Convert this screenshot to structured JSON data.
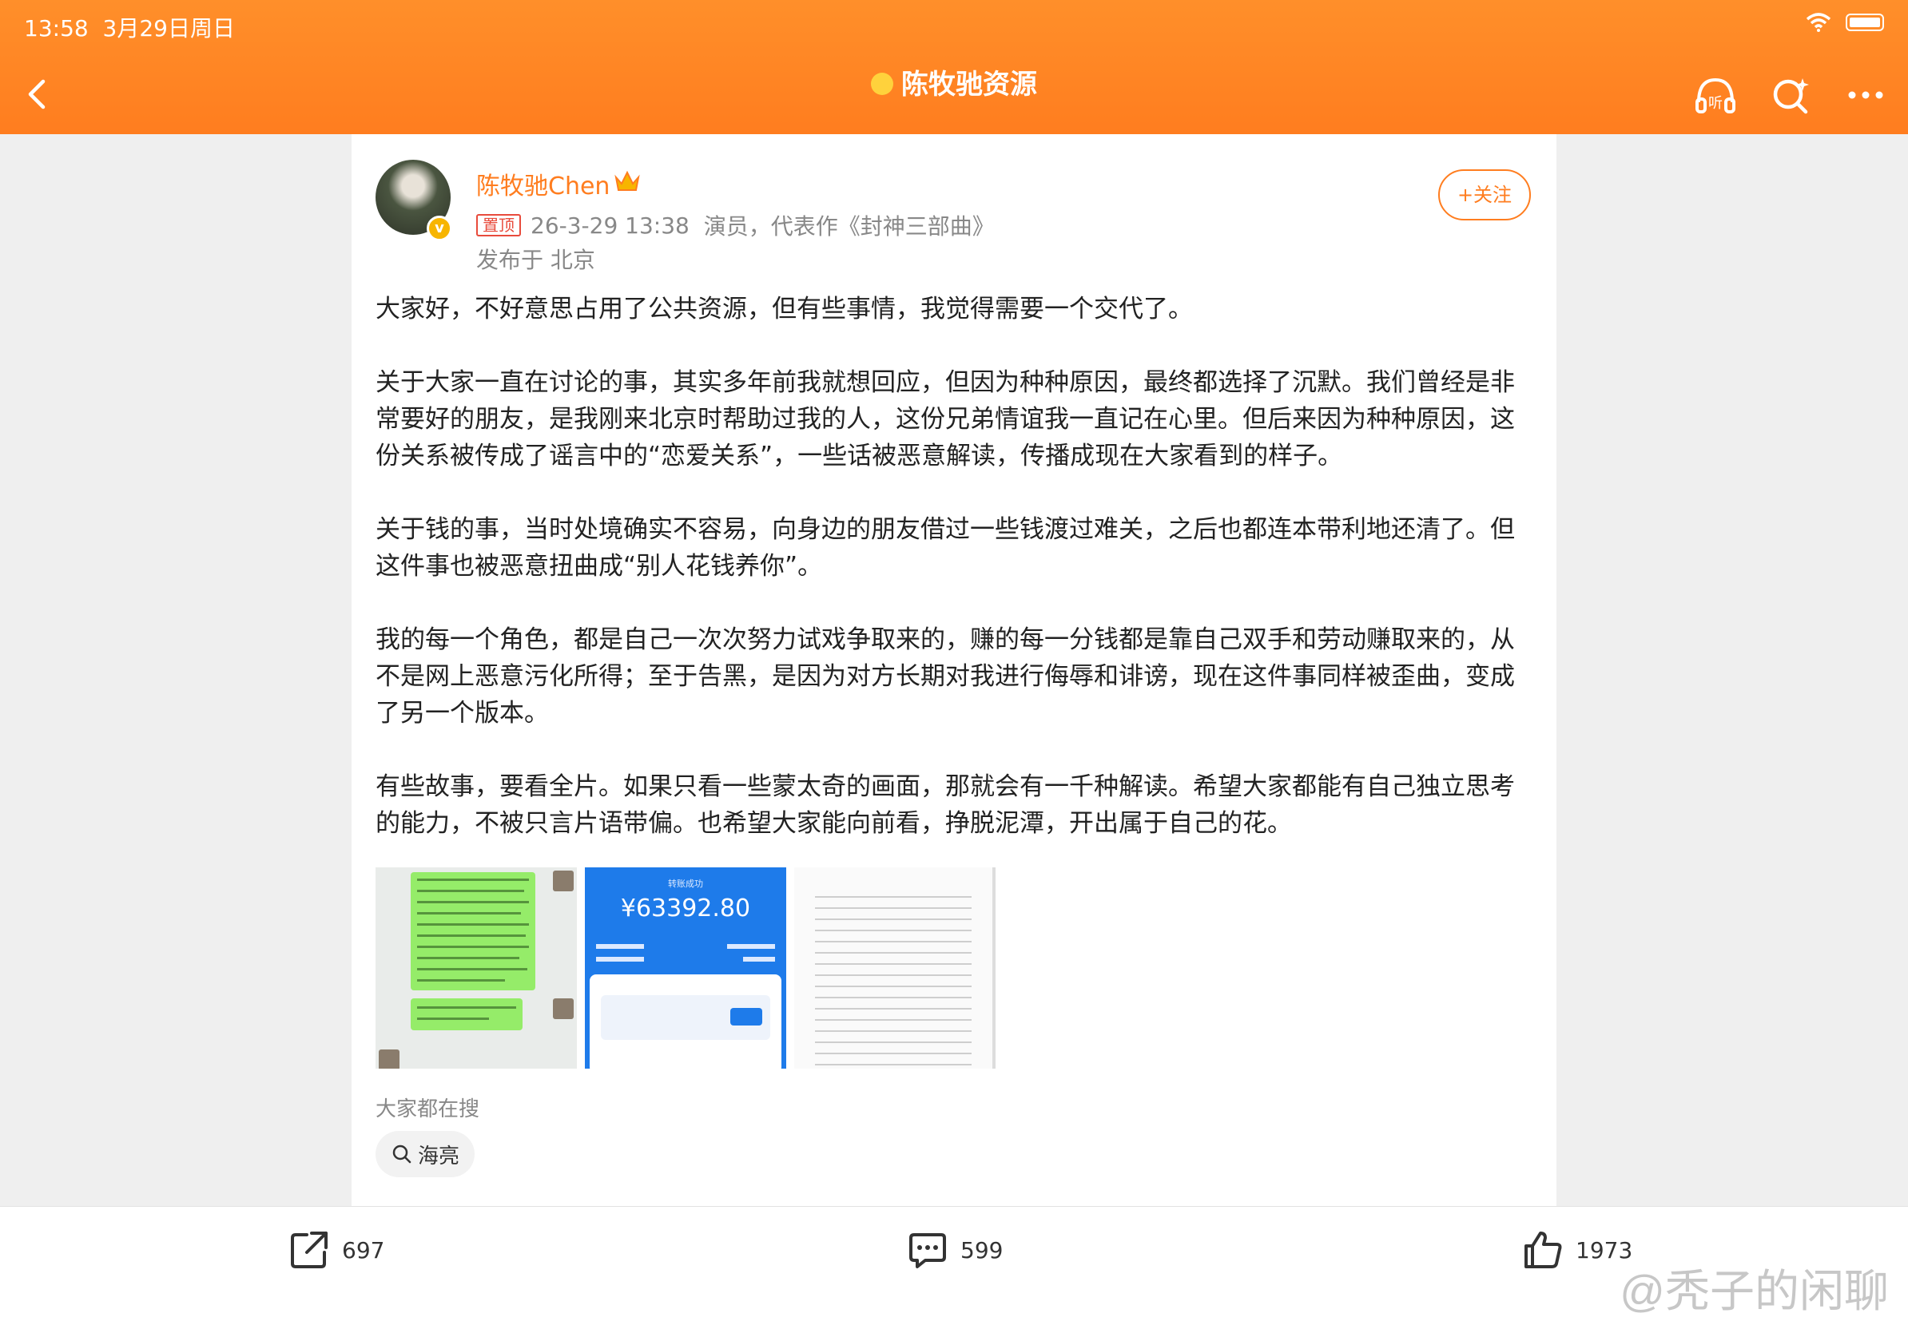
{
  "status_bar": {
    "time": "13:58",
    "date": "3月29日周日"
  },
  "nav": {
    "title": "陈牧驰资源"
  },
  "post": {
    "username": "陈牧驰Chen",
    "pinned_label": "置顶",
    "timestamp": "26-3-29 13:38",
    "description": "演员，代表作《封神三部曲》",
    "location": "发布于 北京",
    "follow_label": "+关注",
    "paragraphs": [
      "大家好，不好意思占用了公共资源，但有些事情，我觉得需要一个交代了。",
      "关于大家一直在讨论的事，其实多年前我就想回应，但因为种种原因，最终都选择了沉默。我们曾经是非常要好的朋友，是我刚来北京时帮助过我的人，这份兄弟情谊我一直记在心里。但后来因为种种原因，这份关系被传成了谣言中的“恋爱关系”，一些话被恶意解读，传播成现在大家看到的样子。",
      "关于钱的事，当时处境确实不容易，向身边的朋友借过一些钱渡过难关，之后也都连本带利地还清了。但这件事也被恶意扭曲成“别人花钱养你”。",
      "我的每一个角色，都是自己一次次努力试戏争取来的，赚的每一分钱都是靠自己双手和劳动赚取来的，从不是网上恶意污化所得；至于告黑，是因为对方长期对我进行侮辱和诽谤，现在这件事同样被歪曲，变成了另一个版本。",
      "有些故事，要看全片。如果只看一些蒙太奇的画面，那就会有一千种解读。希望大家都能有自己独立思考的能力，不被只言片语带偏。也希望大家能向前看，挣脱泥潭，开出属于自己的花。"
    ],
    "images": {
      "payment_title": "转账成功",
      "payment_amount": "¥63392.80"
    },
    "trending_label": "大家都在搜",
    "trending_chip": "海亮"
  },
  "actions": {
    "repost": "697",
    "comment": "599",
    "like": "1973"
  },
  "watermark": "@秃子的闲聊",
  "colors": {
    "brand_orange": "#ff7d1f",
    "pin_red": "#e84b3c",
    "verified_gold": "#f7b500"
  }
}
